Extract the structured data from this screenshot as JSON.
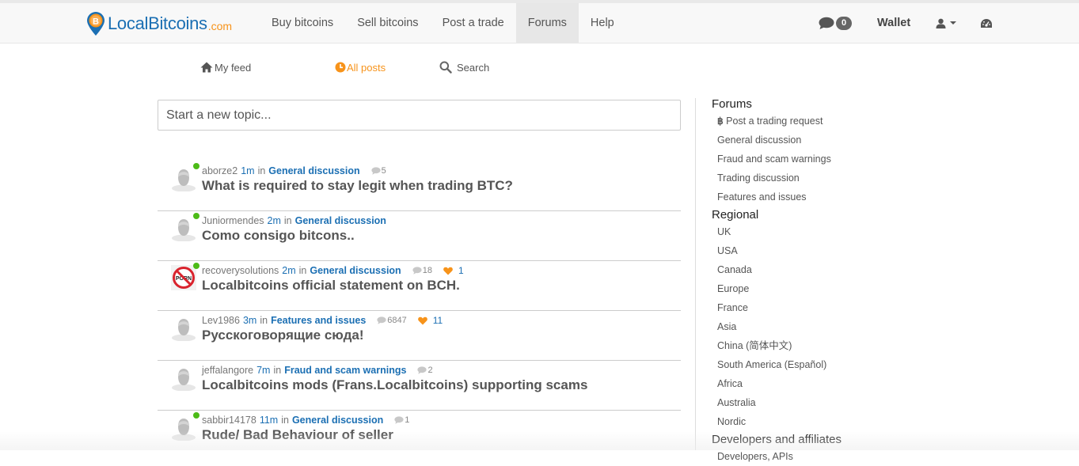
{
  "brand": {
    "name": "LocalBitcoins",
    "suffix": ".com",
    "color": "#1b6fb3",
    "accent": "#f7931a"
  },
  "nav": {
    "items": [
      {
        "label": "Buy bitcoins"
      },
      {
        "label": "Sell bitcoins"
      },
      {
        "label": "Post a trade"
      },
      {
        "label": "Forums",
        "active": true
      },
      {
        "label": "Help"
      }
    ],
    "chat_count": "0",
    "wallet": "Wallet",
    "icons": [
      "chat-icon",
      "user-icon",
      "caret-down-icon",
      "dashboard-icon"
    ]
  },
  "subnav": {
    "my_feed": "My feed",
    "all_posts": "All posts",
    "search": "Search"
  },
  "composer": {
    "placeholder": "Start a new topic..."
  },
  "topics": [
    {
      "user": "aborze2",
      "time": "1m",
      "in": "in",
      "category": "General discussion",
      "comments": "5",
      "likes": "",
      "title": "What is required to stay legit when trading BTC?",
      "online": true,
      "avatar": "default"
    },
    {
      "user": "Juniormendes",
      "time": "2m",
      "in": "in",
      "category": "General discussion",
      "comments": "",
      "likes": "",
      "title": "Como consigo bitcons..",
      "online": true,
      "avatar": "default"
    },
    {
      "user": "recoverysolutions",
      "time": "2m",
      "in": "in",
      "category": "General discussion",
      "comments": "18",
      "likes": "1",
      "title": "Localbitcoins official statement on BCH.",
      "online": true,
      "avatar": "no-porn"
    },
    {
      "user": "Lev1986",
      "time": "3m",
      "in": "in",
      "category": "Features and issues",
      "comments": "6847",
      "likes": "11",
      "title": "Русскоговорящие сюда!",
      "online": false,
      "avatar": "default"
    },
    {
      "user": "jeffalangore",
      "time": "7m",
      "in": "in",
      "category": "Fraud and scam warnings",
      "comments": "2",
      "likes": "",
      "title": "Localbitcoins mods (Frans.Localbitcoins) supporting scams",
      "online": false,
      "avatar": "default"
    },
    {
      "user": "sabbir14178",
      "time": "11m",
      "in": "in",
      "category": "General discussion",
      "comments": "1",
      "likes": "",
      "title": "Rude/ Bad Behaviour of seller",
      "online": true,
      "avatar": "default"
    }
  ],
  "sidebar": {
    "forums_heading": "Forums",
    "forums": [
      "Post a trading request",
      "General discussion",
      "Fraud and scam warnings",
      "Trading discussion",
      "Features and issues"
    ],
    "regional_heading": "Regional",
    "regional": [
      "UK",
      "USA",
      "Canada",
      "Europe",
      "France",
      "Asia",
      "China (简体中文)",
      "South America (Español)",
      "Africa",
      "Australia",
      "Nordic"
    ],
    "dev_heading": "Developers and affiliates",
    "dev": [
      "Developers, APIs"
    ]
  }
}
